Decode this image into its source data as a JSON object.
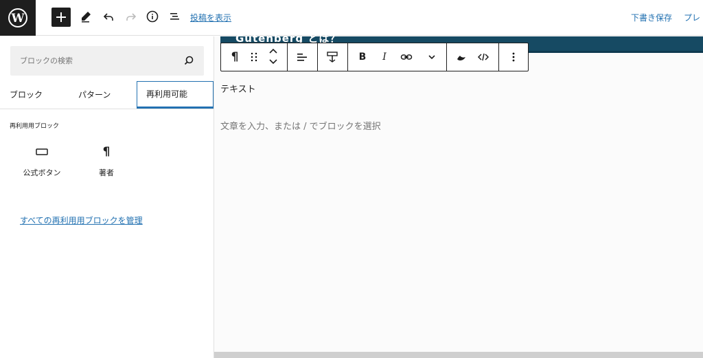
{
  "topbar": {
    "logo_icon": "wordpress-logo",
    "add_icon": "plus-icon",
    "tools_icon": "pencil-icon",
    "undo_icon": "undo-icon",
    "redo_icon": "redo-icon",
    "info_icon": "info-icon",
    "list_view_icon": "list-view-icon",
    "view_post_link": "投稿を表示",
    "save_draft": "下書き保存",
    "preview": "プレ"
  },
  "inserter": {
    "search_placeholder": "ブロックの検索",
    "tabs": [
      {
        "label": "ブロック"
      },
      {
        "label": "パターン"
      },
      {
        "label": "再利用可能"
      }
    ],
    "active_tab": 2,
    "section_title": "再利用用ブロック",
    "blocks": [
      {
        "label": "公式ボタン",
        "icon": "button-icon"
      },
      {
        "label": "著者",
        "icon": "paragraph-icon"
      }
    ],
    "manage_link": "すべての再利用用ブロックを管理"
  },
  "editor": {
    "cover_title": "Gutenberg とは？",
    "text": "テキスト",
    "placeholder": "文章を入力、または / でブロックを選択",
    "toolbar_icons": [
      "paragraph-icon",
      "drag-handle-icon",
      "move-up-icon",
      "move-down-icon",
      "align-left-icon",
      "text-align-icon",
      "bold-icon",
      "italic-icon",
      "link-icon",
      "more-options-chevron-icon",
      "highlight-icon",
      "code-icon",
      "more-vertical-icon"
    ],
    "bold_label": "B",
    "italic_label": "I",
    "paragraph_glyph": "¶"
  },
  "colors": {
    "accent": "#2271b1",
    "dark": "#1e1e1e",
    "cover": "#164a63"
  }
}
